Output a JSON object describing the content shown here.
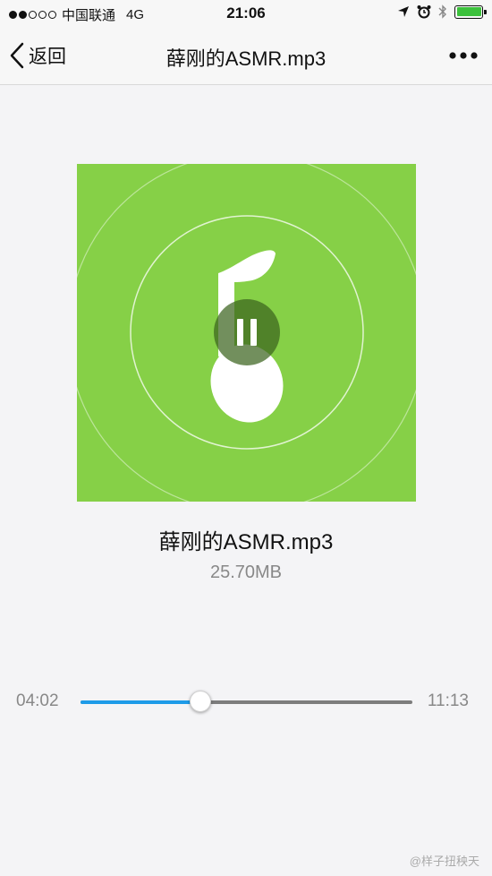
{
  "status_bar": {
    "carrier": "中国联通",
    "network": "4G",
    "time": "21:06"
  },
  "nav": {
    "back_label": "返回",
    "title": "薛刚的ASMR.mp3"
  },
  "file": {
    "name": "薛刚的ASMR.mp3",
    "size": "25.70MB"
  },
  "player": {
    "state": "playing",
    "elapsed": "04:02",
    "duration": "11:13",
    "progress": 0.36,
    "accent_color": "#1e9be8",
    "cover_color": "#86d047"
  },
  "watermark": "@样子扭秧天"
}
